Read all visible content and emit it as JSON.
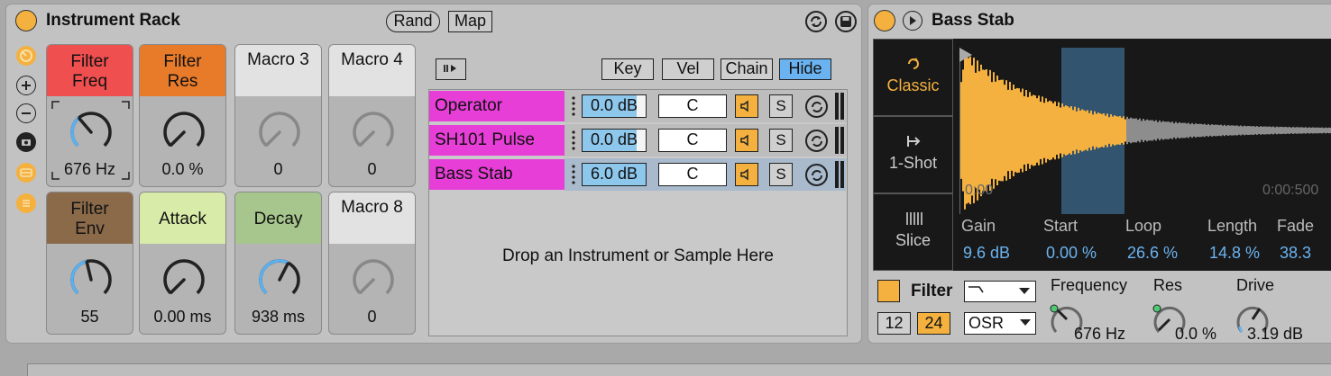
{
  "rack": {
    "title": "Instrument Rack",
    "rand_label": "Rand",
    "map_label": "Map",
    "macros": [
      {
        "label": "Filter\nFreq",
        "value": "676 Hz",
        "color": "#ef4f4f",
        "level": 0.35,
        "mapped": true
      },
      {
        "label": "Filter\nRes",
        "value": "0.0 %",
        "color": "#e87b2a",
        "level": 0.0,
        "mapped": true
      },
      {
        "label": "Macro 3",
        "value": "0",
        "color": "#e2e2e2",
        "level": 0.0,
        "mapped": false
      },
      {
        "label": "Macro 4",
        "value": "0",
        "color": "#e2e2e2",
        "level": 0.0,
        "mapped": false
      },
      {
        "label": "Filter\nEnv",
        "value": "55",
        "color": "#8b6a4a",
        "level": 0.45,
        "mapped": true
      },
      {
        "label": "Attack",
        "value": "0.00 ms",
        "color": "#d8eba8",
        "level": 0.0,
        "mapped": true
      },
      {
        "label": "Decay",
        "value": "938 ms",
        "color": "#a6c68d",
        "level": 0.6,
        "mapped": true
      },
      {
        "label": "Macro 8",
        "value": "0",
        "color": "#e2e2e2",
        "level": 0.0,
        "mapped": false
      }
    ],
    "chain_header": {
      "key": "Key",
      "vel": "Vel",
      "chain": "Chain",
      "hide": "Hide"
    },
    "chains": [
      {
        "name": "Operator",
        "volume": "0.0 dB",
        "volume_level": 0.85,
        "pan": "C",
        "solo": "S",
        "selected": false
      },
      {
        "name": "SH101 Pulse",
        "volume": "0.0 dB",
        "volume_level": 0.85,
        "pan": "C",
        "solo": "S",
        "selected": false
      },
      {
        "name": "Bass Stab",
        "volume": "6.0 dB",
        "volume_level": 1.0,
        "pan": "C",
        "solo": "S",
        "selected": true
      }
    ],
    "drop_text": "Drop an Instrument or Sample Here"
  },
  "simpler": {
    "title": "Bass Stab",
    "modes": [
      {
        "label": "Classic",
        "icon": "loop-icon",
        "active": true
      },
      {
        "label": "1-Shot",
        "icon": "one-shot-icon",
        "active": false
      },
      {
        "label": "Slice",
        "icon": "slice-icon",
        "active": false
      }
    ],
    "time_start": "0:00",
    "time_end": "0:00:500",
    "params": [
      {
        "label": "Gain",
        "value": "9.6 dB"
      },
      {
        "label": "Start",
        "value": "0.00 %"
      },
      {
        "label": "Loop",
        "value": "26.6 %"
      },
      {
        "label": "Length",
        "value": "14.8 %"
      },
      {
        "label": "Fade",
        "value": "38.3"
      }
    ],
    "filter_label": "Filter",
    "filter_type": "┐",
    "filter_slope_12": "12",
    "filter_slope_24": "24",
    "osr_label": "OSR",
    "frequency_label": "Frequency",
    "frequency_value": "676 Hz",
    "res_label": "Res",
    "res_value": "0.0 %",
    "drive_label": "Drive",
    "drive_value": "3.19 dB"
  },
  "colors": {
    "accent": "#f4b13f",
    "blue": "#6bb3f0",
    "chain": "#e63ed6"
  }
}
